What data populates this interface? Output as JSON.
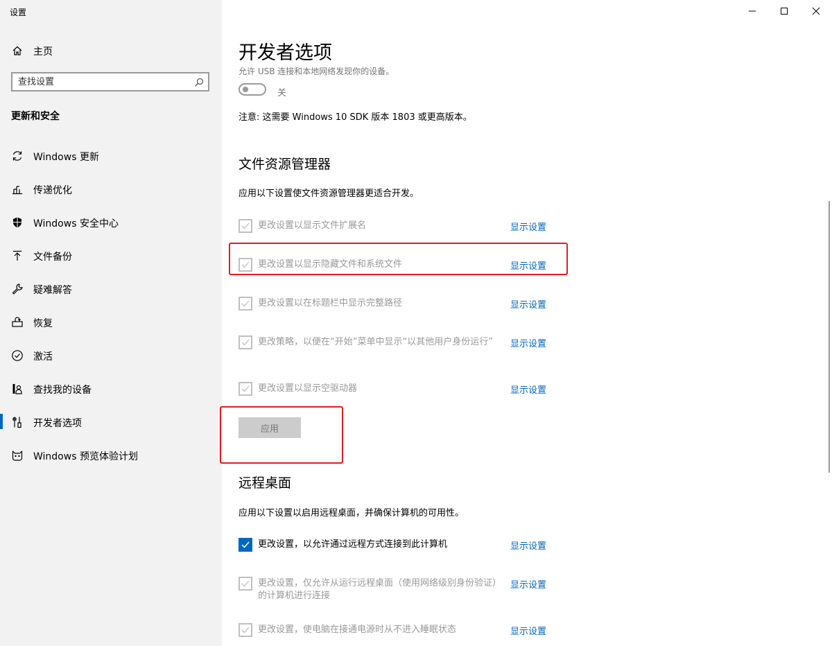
{
  "window": {
    "title": "设置"
  },
  "sidebar": {
    "home_label": "主页",
    "search_placeholder": "查找设置",
    "section_title": "更新和安全",
    "items": [
      {
        "label": "Windows 更新",
        "icon": "sync-icon"
      },
      {
        "label": "传递优化",
        "icon": "delivery-optimization-icon"
      },
      {
        "label": "Windows 安全中心",
        "icon": "shield-icon"
      },
      {
        "label": "文件备份",
        "icon": "backup-arrow-icon"
      },
      {
        "label": "疑难解答",
        "icon": "wrench-icon"
      },
      {
        "label": "恢复",
        "icon": "recovery-icon"
      },
      {
        "label": "激活",
        "icon": "check-circle-icon"
      },
      {
        "label": "查找我的设备",
        "icon": "person-pin-icon"
      },
      {
        "label": "开发者选项",
        "icon": "developer-tools-icon",
        "selected": true
      },
      {
        "label": "Windows 预览体验计划",
        "icon": "insider-cat-icon"
      }
    ]
  },
  "main": {
    "title": "开发者选项",
    "device_desc": "允许 USB 连接和本地网络发现你的设备。",
    "toggle_label": "关",
    "note": "注意: 这需要 Windows 10 SDK 版本 1803 或更高版本。",
    "explorer": {
      "heading": "文件资源管理器",
      "intro": "应用以下设置使文件资源管理器更适合开发。",
      "options": [
        {
          "text": "更改设置以显示文件扩展名",
          "link": "显示设置",
          "checked": true
        },
        {
          "text": "更改设置以显示隐藏文件和系统文件",
          "link": "显示设置",
          "checked": true
        },
        {
          "text": "更改设置以在标题栏中显示完整路径",
          "link": "显示设置",
          "checked": true
        },
        {
          "text": "更改策略，以便在“开始”菜单中显示“以其他用户身份运行”",
          "link": "显示设置",
          "checked": true
        },
        {
          "text": "更改设置以显示空驱动器",
          "link": "显示设置",
          "checked": true
        }
      ],
      "apply_label": "应用"
    },
    "remote": {
      "heading": "远程桌面",
      "intro": "应用以下设置以启用远程桌面，并确保计算机的可用性。",
      "options": [
        {
          "text": "更改设置，以允许通过远程方式连接到此计算机",
          "link": "显示设置",
          "checked": true,
          "active": true
        },
        {
          "text": "更改设置，仅允许从运行远程桌面（使用网络级别身份验证）的计算机进行连接",
          "link": "显示设置",
          "checked": true
        },
        {
          "text": "更改设置，使电脑在接通电源时从不进入睡眠状态",
          "link": "显示设置",
          "checked": true
        }
      ]
    }
  },
  "colors": {
    "accent": "#0067c0",
    "highlight_box": "#e21b1b"
  }
}
